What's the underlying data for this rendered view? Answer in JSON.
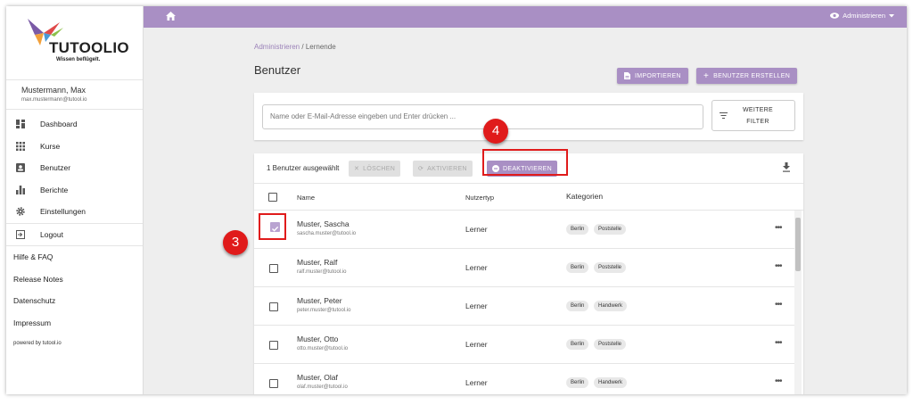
{
  "brand": {
    "name": "TUTOOLIO",
    "slogan": "Wissen beflügelt."
  },
  "user": {
    "name": "Mustermann, Max",
    "email": "max.mustermann@tutool.io"
  },
  "sidebar": {
    "items": [
      {
        "label": "Dashboard",
        "icon": "dashboard-icon"
      },
      {
        "label": "Kurse",
        "icon": "grid-icon"
      },
      {
        "label": "Benutzer",
        "icon": "user-card-icon"
      },
      {
        "label": "Berichte",
        "icon": "bar-chart-icon"
      },
      {
        "label": "Einstellungen",
        "icon": "gear-icon"
      }
    ],
    "logout": "Logout",
    "links": [
      "Hilfe & FAQ",
      "Release Notes",
      "Datenschutz",
      "Impressum"
    ],
    "powered": "powered by tutool.io"
  },
  "topbar": {
    "admin_label": "Administrieren"
  },
  "breadcrumb": {
    "parent": "Administrieren",
    "separator": "/",
    "current": "Lernende"
  },
  "page": {
    "title": "Benutzer"
  },
  "actions": {
    "import": "IMPORTIEREN",
    "create": "BENUTZER ERSTELLEN"
  },
  "search": {
    "placeholder": "Name oder E-Mail-Adresse eingeben und Enter drücken ...",
    "filter_line1": "WEITERE",
    "filter_line2": "FILTER"
  },
  "toolbar": {
    "selected": "1 Benutzer ausgewählt",
    "delete": "LÖSCHEN",
    "activate": "AKTIVIEREN",
    "deactivate": "DEAKTIVIEREN"
  },
  "table": {
    "headers": {
      "name": "Name",
      "type": "Nutzertyp",
      "categories": "Kategorien"
    },
    "rows": [
      {
        "name": "Muster, Sascha",
        "email": "sascha.muster@tutool.io",
        "type": "Lerner",
        "cat1": "Berlin",
        "cat2": "Poststelle",
        "checked": true
      },
      {
        "name": "Muster, Ralf",
        "email": "ralf.muster@tutool.io",
        "type": "Lerner",
        "cat1": "Berlin",
        "cat2": "Poststelle",
        "checked": false
      },
      {
        "name": "Muster, Peter",
        "email": "peter.muster@tutool.io",
        "type": "Lerner",
        "cat1": "Berlin",
        "cat2": "Handwerk",
        "checked": false
      },
      {
        "name": "Muster, Otto",
        "email": "otto.muster@tutool.io",
        "type": "Lerner",
        "cat1": "Berlin",
        "cat2": "Poststelle",
        "checked": false
      },
      {
        "name": "Muster, Olaf",
        "email": "olaf.muster@tutool.io",
        "type": "Lerner",
        "cat1": "Berlin",
        "cat2": "Handwerk",
        "checked": false
      }
    ]
  },
  "annotations": {
    "step3": "3",
    "step4": "4"
  },
  "colors": {
    "accent": "#a98fc4",
    "marker": "#e01b1b"
  }
}
